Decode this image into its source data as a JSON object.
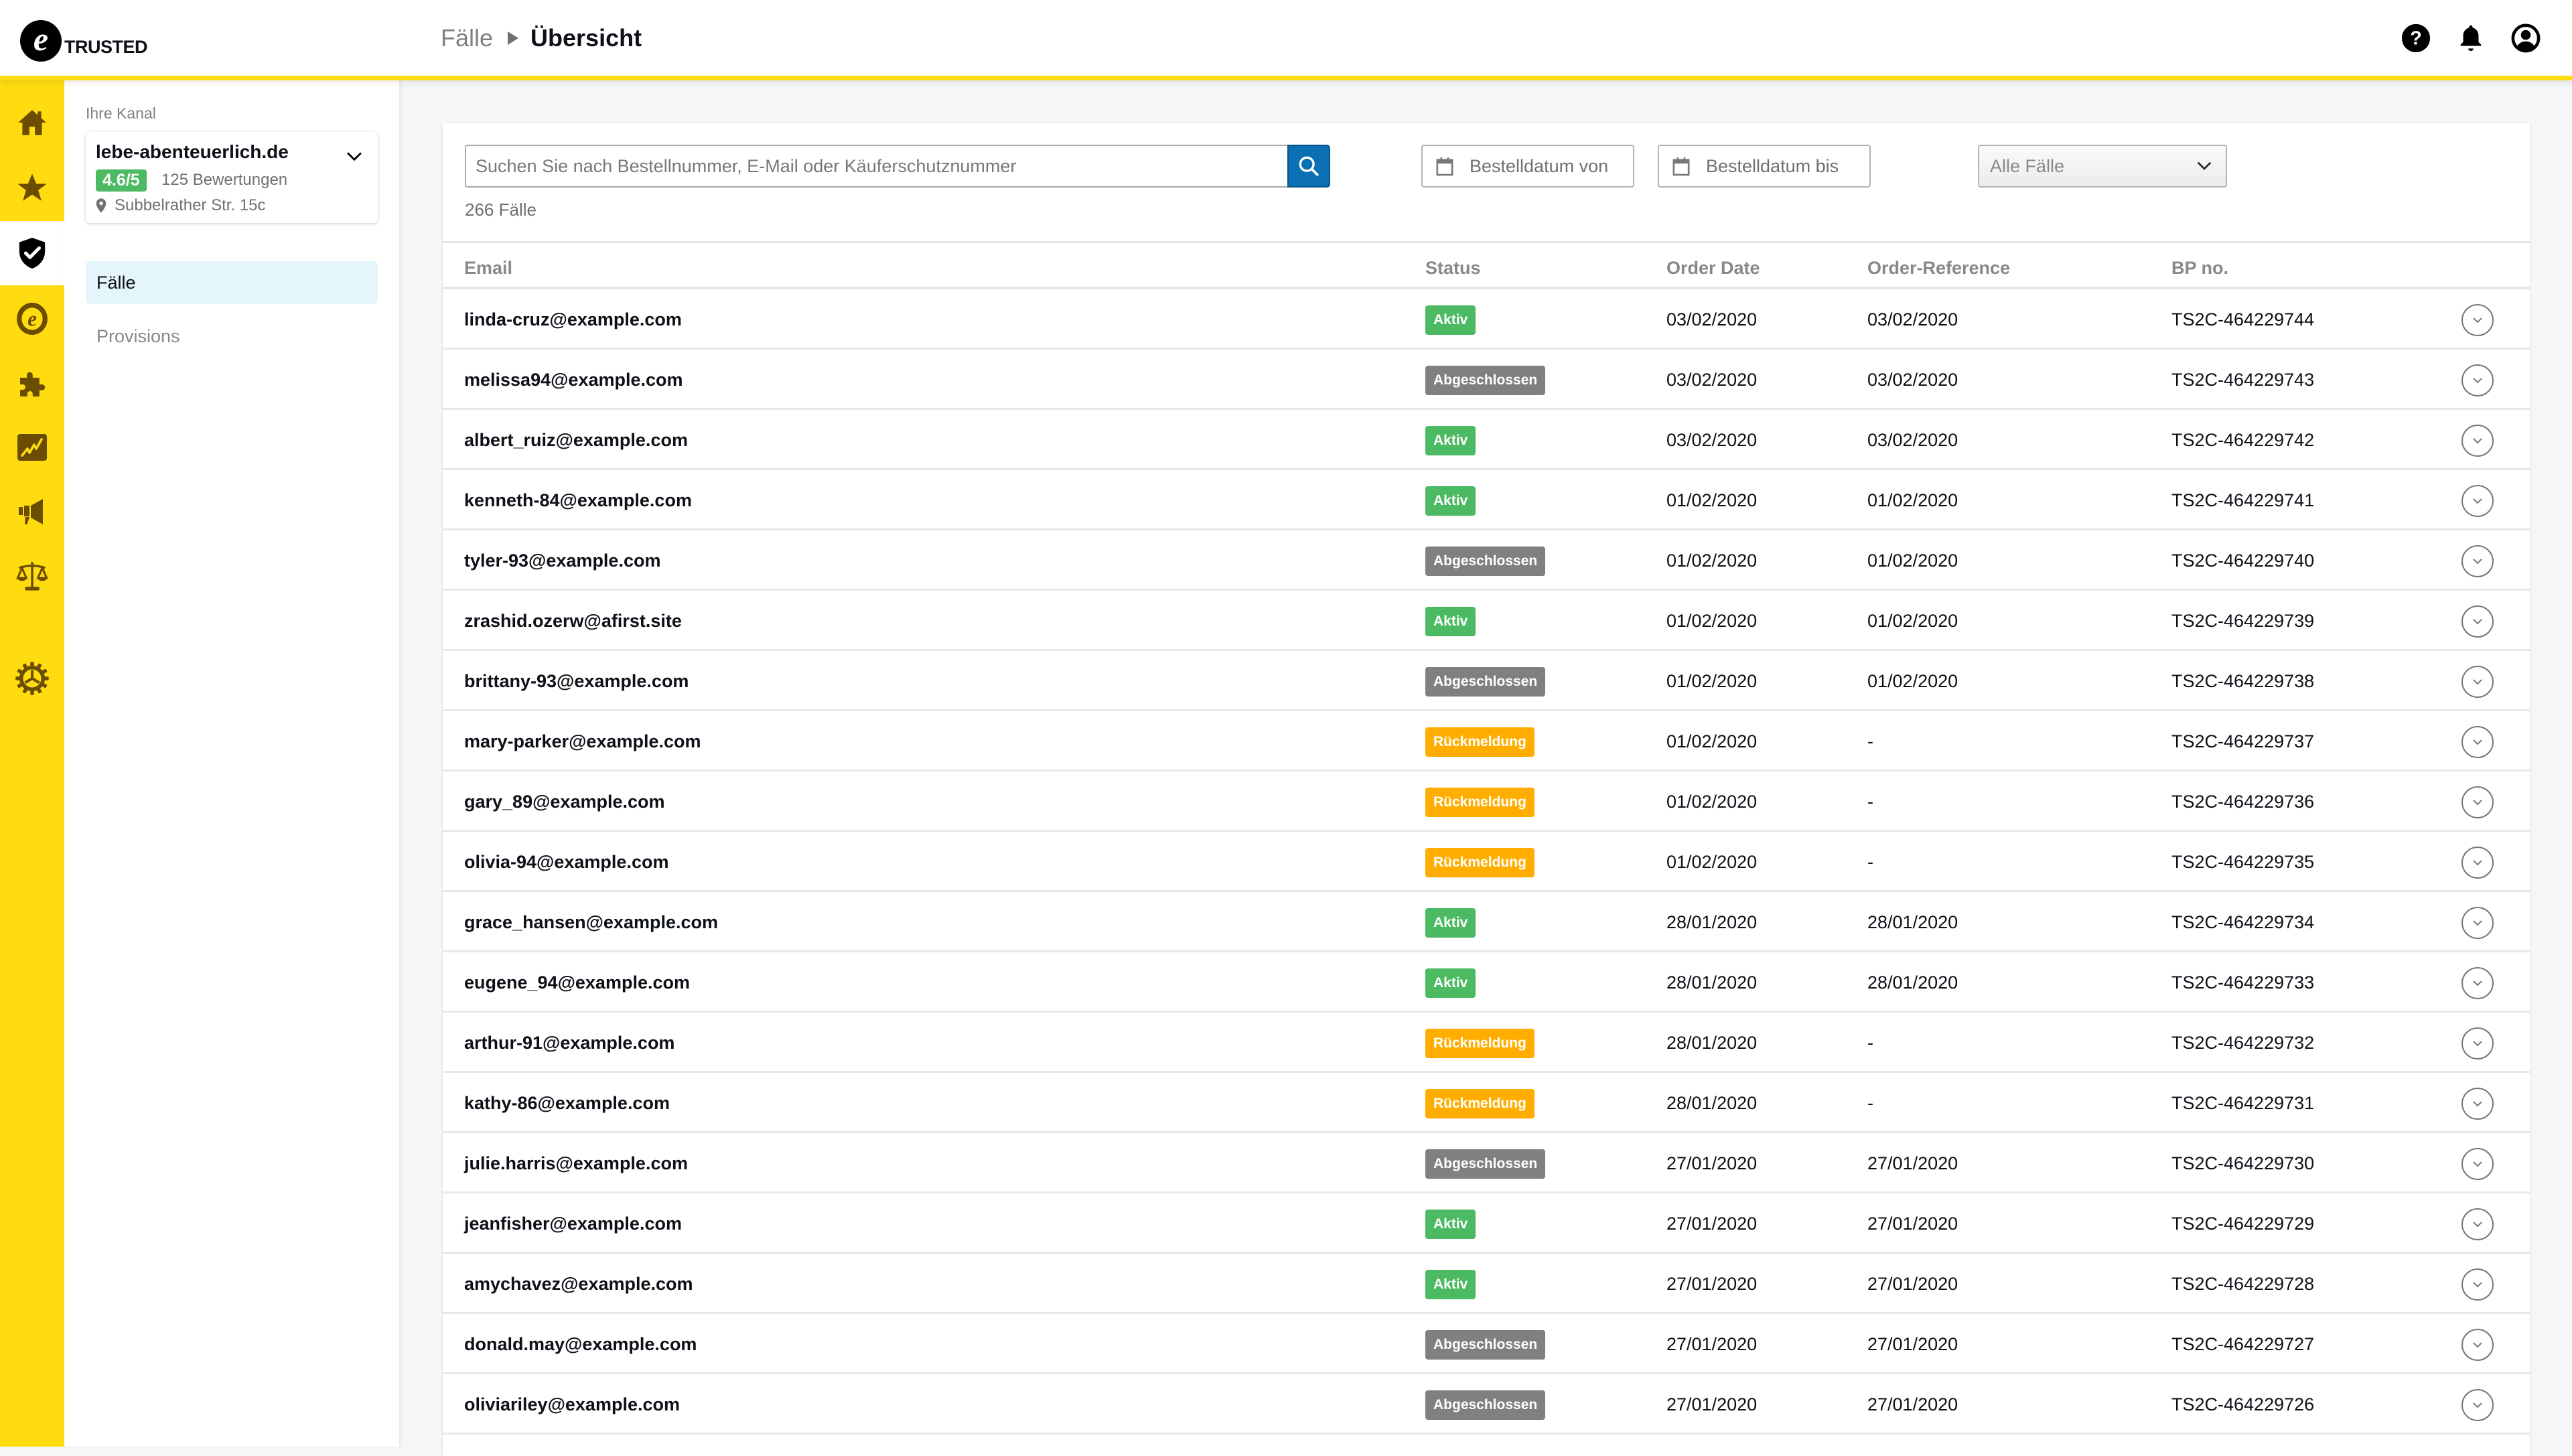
{
  "header": {
    "logo_text": "TRUSTED",
    "logo_mark": "e",
    "breadcrumb": {
      "parent": "Fälle",
      "current": "Übersicht"
    },
    "icons": [
      "help-icon",
      "bell-icon",
      "account-icon"
    ]
  },
  "rail": {
    "items": [
      {
        "icon": "home-icon",
        "active": false
      },
      {
        "icon": "star-icon",
        "active": false
      },
      {
        "icon": "shield-check-icon",
        "active": true
      },
      {
        "icon": "etrusted-icon",
        "active": false
      },
      {
        "icon": "puzzle-icon",
        "active": false
      },
      {
        "icon": "chart-icon",
        "active": false
      },
      {
        "icon": "megaphone-icon",
        "active": false
      },
      {
        "icon": "scale-icon",
        "active": false
      },
      {
        "icon": "gear-icon",
        "active": false
      }
    ]
  },
  "colors": {
    "brand_yellow": "#ffdc0f",
    "rail_icon": "#6b4c00",
    "status_aktiv": "#4cb963",
    "status_abgeschlossen": "#808080",
    "status_rueckmeldung": "#ffae00",
    "search_button": "#0a6fb3",
    "active_nav_bg": "#e4f6fb"
  },
  "subnav": {
    "kanal_label": "Ihre Kanal",
    "kanal": {
      "name": "lebe-abenteuerlich.de",
      "rating": "4.6/5",
      "reviews": "125 Bewertungen",
      "address": "Subbelrather Str. 15c"
    },
    "items": [
      {
        "label": "Fälle",
        "active": true
      },
      {
        "label": "Provisions",
        "active": false
      }
    ]
  },
  "filters": {
    "search_placeholder": "Suchen Sie nach Bestellnummer, E-Mail oder Käuferschutznummer",
    "search_value": "",
    "count": "266 Fälle",
    "date_from": "Bestelldatum von",
    "date_to": "Bestelldatum bis",
    "case_filter": "Alle Fälle"
  },
  "table": {
    "columns": [
      "Email",
      "Status",
      "Order Date",
      "Order-Reference",
      "BP no."
    ],
    "rows": [
      {
        "email": "linda-cruz@example.com",
        "status": "Aktiv",
        "order_date": "03/02/2020",
        "order_ref": "03/02/2020",
        "bp": "TS2C-464229744"
      },
      {
        "email": "melissa94@example.com",
        "status": "Abgeschlossen",
        "order_date": "03/02/2020",
        "order_ref": "03/02/2020",
        "bp": "TS2C-464229743"
      },
      {
        "email": "albert_ruiz@example.com",
        "status": "Aktiv",
        "order_date": "03/02/2020",
        "order_ref": "03/02/2020",
        "bp": "TS2C-464229742"
      },
      {
        "email": "kenneth-84@example.com",
        "status": "Aktiv",
        "order_date": "01/02/2020",
        "order_ref": "01/02/2020",
        "bp": "TS2C-464229741"
      },
      {
        "email": "tyler-93@example.com",
        "status": "Abgeschlossen",
        "order_date": "01/02/2020",
        "order_ref": "01/02/2020",
        "bp": "TS2C-464229740"
      },
      {
        "email": "zrashid.ozerw@afirst.site",
        "status": "Aktiv",
        "order_date": "01/02/2020",
        "order_ref": "01/02/2020",
        "bp": "TS2C-464229739"
      },
      {
        "email": "brittany-93@example.com",
        "status": "Abgeschlossen",
        "order_date": "01/02/2020",
        "order_ref": "01/02/2020",
        "bp": "TS2C-464229738"
      },
      {
        "email": "mary-parker@example.com",
        "status": "Rückmeldung",
        "order_date": "01/02/2020",
        "order_ref": "-",
        "bp": "TS2C-464229737"
      },
      {
        "email": "gary_89@example.com",
        "status": "Rückmeldung",
        "order_date": "01/02/2020",
        "order_ref": "-",
        "bp": "TS2C-464229736"
      },
      {
        "email": "olivia-94@example.com",
        "status": "Rückmeldung",
        "order_date": "01/02/2020",
        "order_ref": "-",
        "bp": "TS2C-464229735"
      },
      {
        "email": "grace_hansen@example.com",
        "status": "Aktiv",
        "order_date": "28/01/2020",
        "order_ref": "28/01/2020",
        "bp": "TS2C-464229734"
      },
      {
        "email": "eugene_94@example.com",
        "status": "Aktiv",
        "order_date": "28/01/2020",
        "order_ref": "28/01/2020",
        "bp": "TS2C-464229733"
      },
      {
        "email": "arthur-91@example.com",
        "status": "Rückmeldung",
        "order_date": "28/01/2020",
        "order_ref": "-",
        "bp": "TS2C-464229732"
      },
      {
        "email": "kathy-86@example.com",
        "status": "Rückmeldung",
        "order_date": "28/01/2020",
        "order_ref": "-",
        "bp": "TS2C-464229731"
      },
      {
        "email": "julie.harris@example.com",
        "status": "Abgeschlossen",
        "order_date": "27/01/2020",
        "order_ref": "27/01/2020",
        "bp": "TS2C-464229730"
      },
      {
        "email": "jeanfisher@example.com",
        "status": "Aktiv",
        "order_date": "27/01/2020",
        "order_ref": "27/01/2020",
        "bp": "TS2C-464229729"
      },
      {
        "email": "amychavez@example.com",
        "status": "Aktiv",
        "order_date": "27/01/2020",
        "order_ref": "27/01/2020",
        "bp": "TS2C-464229728"
      },
      {
        "email": "donald.may@example.com",
        "status": "Abgeschlossen",
        "order_date": "27/01/2020",
        "order_ref": "27/01/2020",
        "bp": "TS2C-464229727"
      },
      {
        "email": "oliviariley@example.com",
        "status": "Abgeschlossen",
        "order_date": "27/01/2020",
        "order_ref": "27/01/2020",
        "bp": "TS2C-464229726"
      }
    ]
  }
}
